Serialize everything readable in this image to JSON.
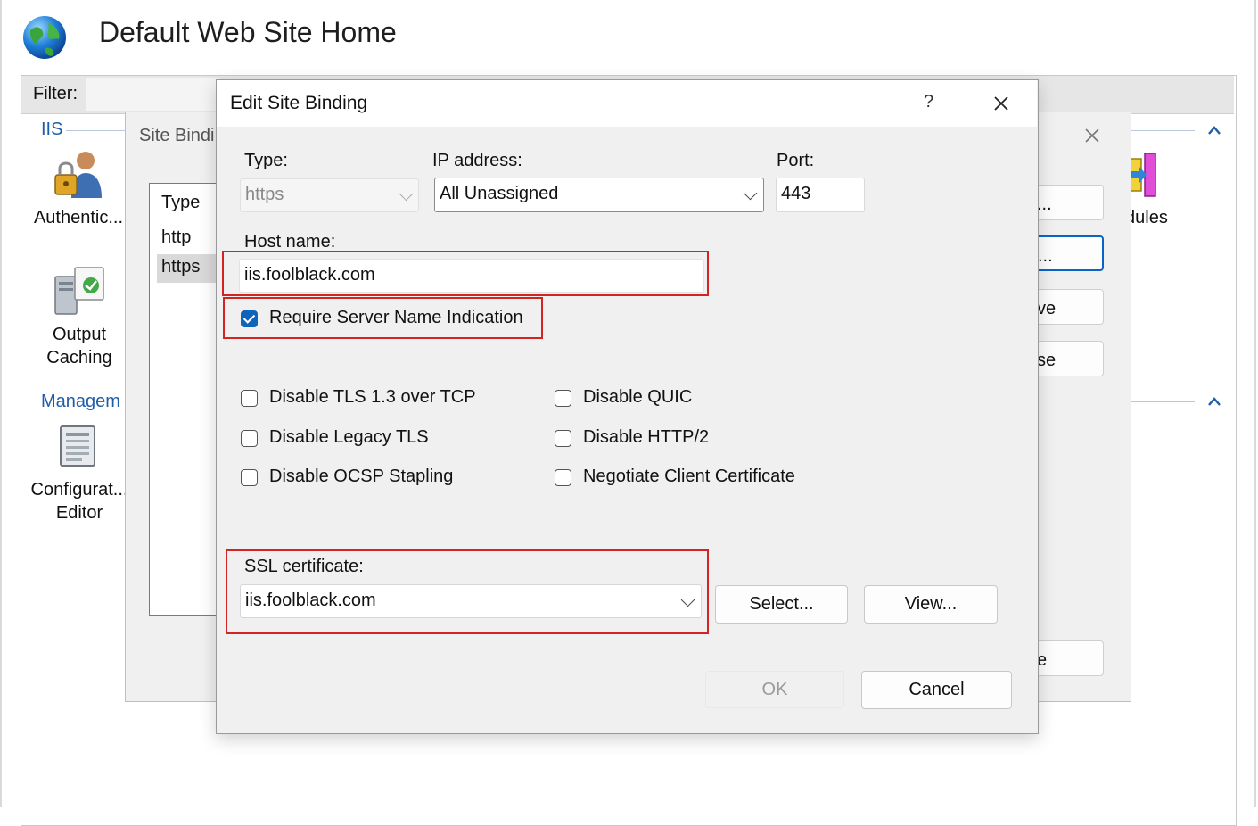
{
  "page": {
    "title": "Default Web Site Home",
    "filter_label": "Filter:",
    "group_iis": "IIS",
    "group_management": "Managem",
    "features": {
      "authentication": "Authentic...",
      "output_caching_1": "Output",
      "output_caching_2": "Caching",
      "config_editor_1": "Configurat...",
      "config_editor_2": "Editor",
      "modules": "dules"
    }
  },
  "site_bindings": {
    "title": "Site Bindi",
    "column_type": "Type",
    "rows": [
      "http",
      "https"
    ],
    "buttons": [
      "...",
      "...",
      "ve",
      "se",
      "e"
    ]
  },
  "edit_site_binding": {
    "title": "Edit Site Binding",
    "help": "?",
    "type_label": "Type:",
    "type_value": "https",
    "ip_label": "IP address:",
    "ip_value": "All Unassigned",
    "port_label": "Port:",
    "port_value": "443",
    "host_label": "Host name:",
    "host_value": "iis.foolblack.com",
    "sni_label": "Require Server Name Indication",
    "sni_checked": true,
    "options": {
      "disable_tls13": "Disable TLS 1.3 over TCP",
      "disable_legacy_tls": "Disable Legacy TLS",
      "disable_ocsp": "Disable OCSP Stapling",
      "disable_quic": "Disable QUIC",
      "disable_http2": "Disable HTTP/2",
      "negotiate_client_cert": "Negotiate Client Certificate"
    },
    "ssl_label": "SSL certificate:",
    "ssl_value": "iis.foolblack.com",
    "select_button": "Select...",
    "view_button": "View...",
    "ok_button": "OK",
    "cancel_button": "Cancel"
  },
  "colors": {
    "highlight": "#d42323",
    "accent": "#0f63bd",
    "link": "#1e5ea8"
  }
}
